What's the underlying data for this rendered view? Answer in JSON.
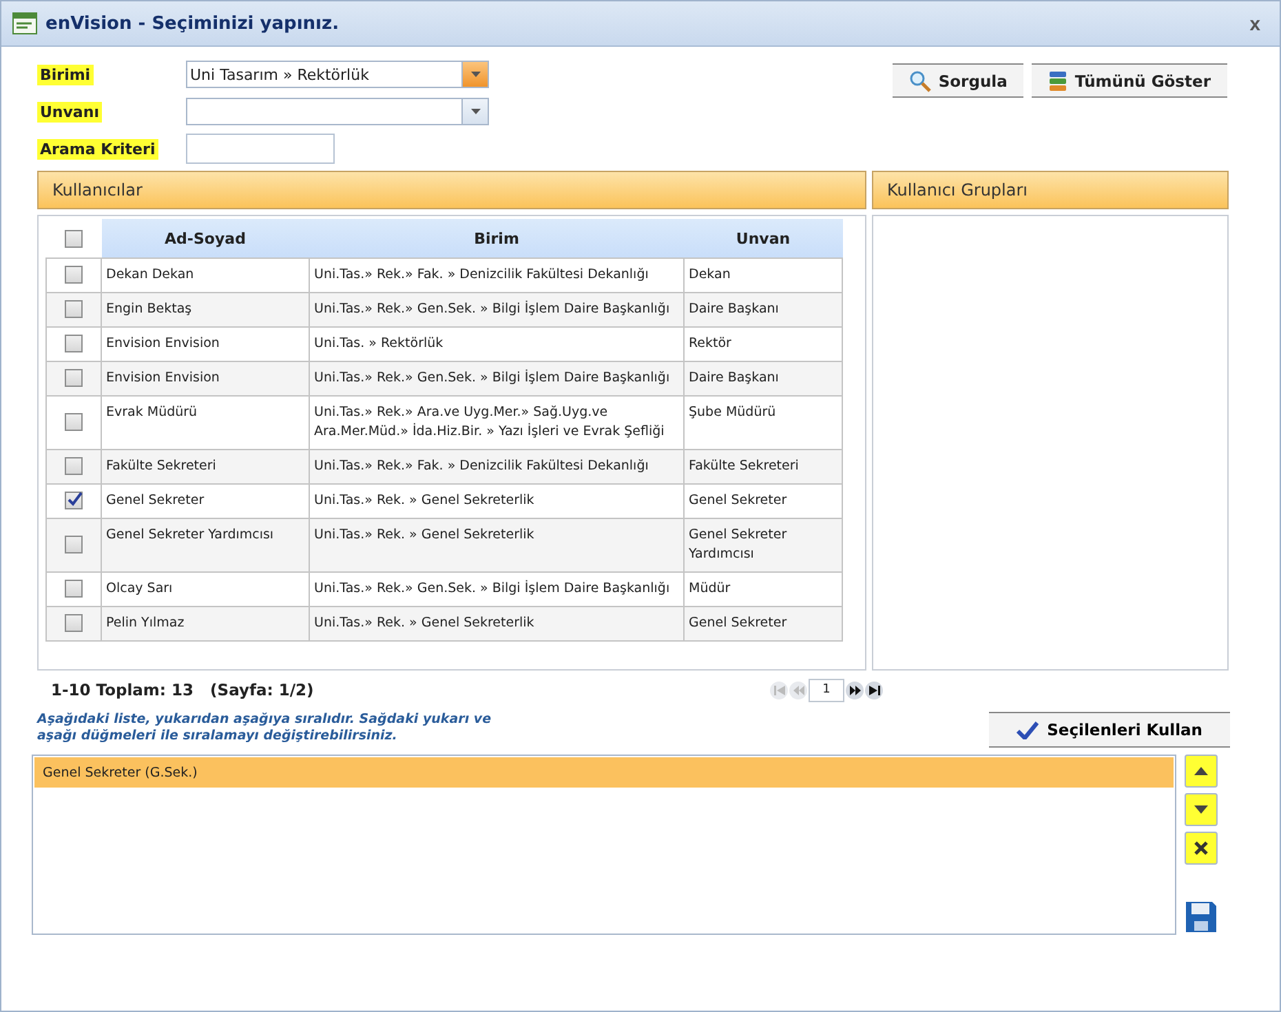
{
  "window": {
    "title": "enVision - Seçiminizi yapınız.",
    "close": "x"
  },
  "filters": [
    {
      "label": "Birimi",
      "highlighted": true,
      "kind": "dropdown",
      "value": "Uni Tasarım » Rektörlük",
      "focused": true
    },
    {
      "label": "Unvanı",
      "highlighted": true,
      "kind": "dropdown",
      "focused": false
    },
    {
      "label": "Arama Kriteri",
      "highlighted": true,
      "kind": "text"
    }
  ],
  "actions": [
    "Sorgula",
    "Tümünü Göster"
  ],
  "users_panel": {
    "title": "Kullanıcılar",
    "select_all": false,
    "columns": [
      "Ad-Soyad",
      "Birim",
      "Unvan"
    ],
    "rows": [
      {
        "checked": false,
        "cells": [
          "Dekan Dekan",
          "Uni.Tas.» Rek.» Fak. » Denizcilik Fakültesi Dekanlığı",
          "Dekan"
        ]
      },
      {
        "checked": false,
        "cells": [
          "Engin Bektaş",
          "Uni.Tas.» Rek.» Gen.Sek. » Bilgi İşlem Daire Başkanlığı",
          "Daire Başkanı"
        ]
      },
      {
        "checked": false,
        "cells": [
          "Envision Envision",
          "Uni.Tas. » Rektörlük",
          "Rektör"
        ]
      },
      {
        "checked": false,
        "cells": [
          "Envision Envision",
          "Uni.Tas.» Rek.» Gen.Sek. » Bilgi İşlem Daire Başkanlığı",
          "Daire Başkanı"
        ]
      },
      {
        "checked": false,
        "cells": [
          "Evrak Müdürü",
          "Uni.Tas.» Rek.» Ara.ve Uyg.Mer.» Sağ.Uyg.ve Ara.Mer.Müd.» İda.Hiz.Bir. » Yazı İşleri ve Evrak Şefliği",
          "Şube Müdürü"
        ]
      },
      {
        "checked": false,
        "cells": [
          "Fakülte Sekreteri",
          "Uni.Tas.» Rek.» Fak. » Denizcilik Fakültesi Dekanlığı",
          "Fakülte Sekreteri"
        ]
      },
      {
        "checked": true,
        "cells": [
          "Genel Sekreter",
          "Uni.Tas.» Rek. » Genel Sekreterlik",
          "Genel Sekreter"
        ]
      },
      {
        "checked": false,
        "cells": [
          "Genel Sekreter Yardımcısı",
          "Uni.Tas.» Rek. » Genel Sekreterlik",
          "Genel Sekreter Yardımcısı"
        ]
      },
      {
        "checked": false,
        "cells": [
          "Olcay Sarı",
          "Uni.Tas.» Rek.» Gen.Sek. » Bilgi İşlem Daire Başkanlığı",
          "Müdür"
        ]
      },
      {
        "checked": false,
        "cells": [
          "Pelin Yılmaz",
          "Uni.Tas.» Rek. » Genel Sekreterlik",
          "Genel Sekreter"
        ]
      }
    ],
    "summary": "1-10 Toplam: 13   (Sayfa: 1/2)",
    "page": "1"
  },
  "groups_panel": {
    "title": "Kullanıcı Grupları"
  },
  "instruction": "Aşağıdaki liste, yukarıdan aşağıya sıralıdır. Sağdaki yukarı ve aşağı düğmeleri ile sıralamayı değiştirebilirsiniz.",
  "use_selected": "Seçilenleri Kullan",
  "selected_list": [
    {
      "label": "Genel Sekreter (G.Sek.)",
      "selected": true
    }
  ],
  "order_buttons": [
    {
      "kind": "up",
      "highlighted": true
    },
    {
      "kind": "down",
      "highlighted": true
    },
    {
      "kind": "remove",
      "highlighted": true
    },
    {
      "kind": "save"
    }
  ]
}
